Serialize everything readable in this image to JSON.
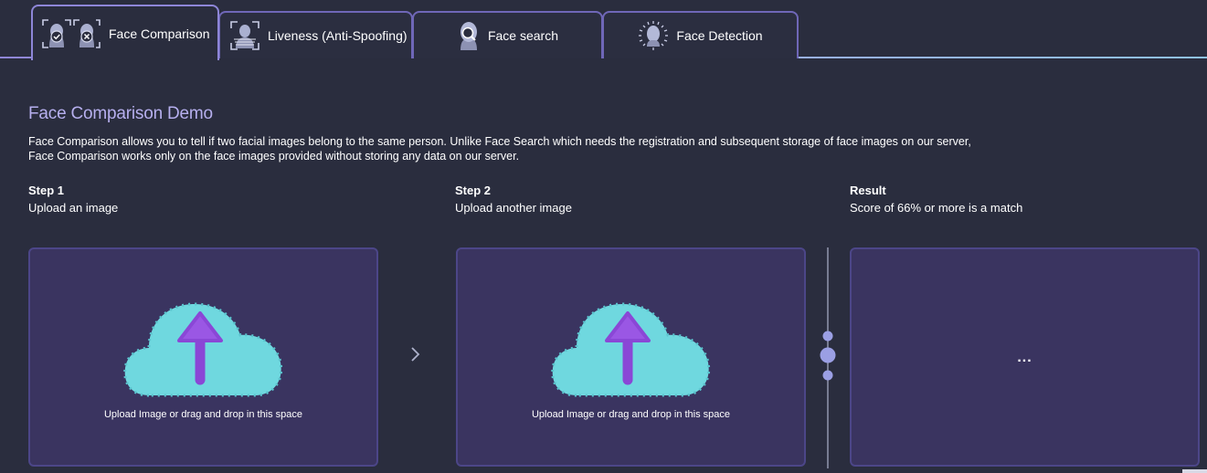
{
  "tabs": [
    {
      "label": "Face Comparison",
      "icon": "face-compare-icon",
      "active": true
    },
    {
      "label": "Liveness (Anti-Spoofing)",
      "icon": "liveness-icon",
      "active": false
    },
    {
      "label": "Face search",
      "icon": "face-search-icon",
      "active": false
    },
    {
      "label": "Face Detection",
      "icon": "face-detection-icon",
      "active": false
    }
  ],
  "main": {
    "title": "Face Comparison Demo",
    "description_line1": "Face Comparison allows you to tell if two facial images belong to the same person. Unlike Face Search which needs the registration and subsequent storage of face images on our server,",
    "description_line2": "Face Comparison works only on the face images provided without storing any data on our server."
  },
  "steps": [
    {
      "title": "Step 1",
      "subtitle": "Upload an image",
      "hint": "Upload Image or drag and drop in this space"
    },
    {
      "title": "Step 2",
      "subtitle": "Upload another image",
      "hint": "Upload Image or drag and drop in this space"
    }
  ],
  "result": {
    "title": "Result",
    "subtitle": "Score of 66% or more is a match",
    "value": "..."
  },
  "icons": {
    "upload": "upload-cloud-icon",
    "next": "chevron-right-icon",
    "divider": "slider-handle-icon"
  },
  "colors": {
    "background": "#2a2d3e",
    "accent": "#b6afee",
    "panel": "#3a3460",
    "panel_border": "#4c4688",
    "cloud": "#6fd8df",
    "arrow": "#8a47d6"
  }
}
